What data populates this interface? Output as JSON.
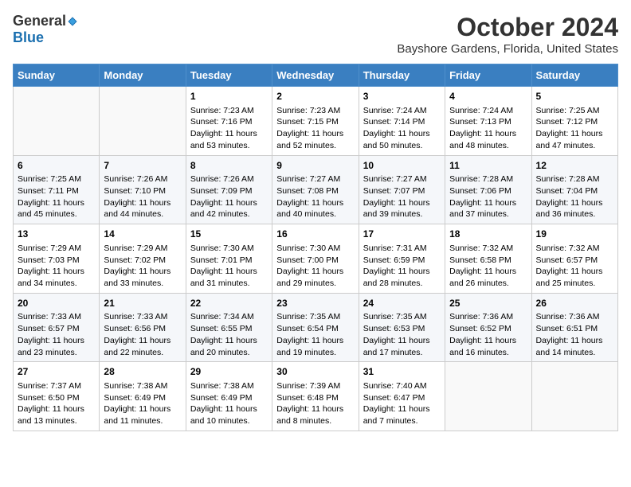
{
  "header": {
    "logo_general": "General",
    "logo_blue": "Blue",
    "month_title": "October 2024",
    "location": "Bayshore Gardens, Florida, United States"
  },
  "days_of_week": [
    "Sunday",
    "Monday",
    "Tuesday",
    "Wednesday",
    "Thursday",
    "Friday",
    "Saturday"
  ],
  "weeks": [
    [
      {
        "day": "",
        "data": ""
      },
      {
        "day": "",
        "data": ""
      },
      {
        "day": "1",
        "data": "Sunrise: 7:23 AM\nSunset: 7:16 PM\nDaylight: 11 hours and 53 minutes."
      },
      {
        "day": "2",
        "data": "Sunrise: 7:23 AM\nSunset: 7:15 PM\nDaylight: 11 hours and 52 minutes."
      },
      {
        "day": "3",
        "data": "Sunrise: 7:24 AM\nSunset: 7:14 PM\nDaylight: 11 hours and 50 minutes."
      },
      {
        "day": "4",
        "data": "Sunrise: 7:24 AM\nSunset: 7:13 PM\nDaylight: 11 hours and 48 minutes."
      },
      {
        "day": "5",
        "data": "Sunrise: 7:25 AM\nSunset: 7:12 PM\nDaylight: 11 hours and 47 minutes."
      }
    ],
    [
      {
        "day": "6",
        "data": "Sunrise: 7:25 AM\nSunset: 7:11 PM\nDaylight: 11 hours and 45 minutes."
      },
      {
        "day": "7",
        "data": "Sunrise: 7:26 AM\nSunset: 7:10 PM\nDaylight: 11 hours and 44 minutes."
      },
      {
        "day": "8",
        "data": "Sunrise: 7:26 AM\nSunset: 7:09 PM\nDaylight: 11 hours and 42 minutes."
      },
      {
        "day": "9",
        "data": "Sunrise: 7:27 AM\nSunset: 7:08 PM\nDaylight: 11 hours and 40 minutes."
      },
      {
        "day": "10",
        "data": "Sunrise: 7:27 AM\nSunset: 7:07 PM\nDaylight: 11 hours and 39 minutes."
      },
      {
        "day": "11",
        "data": "Sunrise: 7:28 AM\nSunset: 7:06 PM\nDaylight: 11 hours and 37 minutes."
      },
      {
        "day": "12",
        "data": "Sunrise: 7:28 AM\nSunset: 7:04 PM\nDaylight: 11 hours and 36 minutes."
      }
    ],
    [
      {
        "day": "13",
        "data": "Sunrise: 7:29 AM\nSunset: 7:03 PM\nDaylight: 11 hours and 34 minutes."
      },
      {
        "day": "14",
        "data": "Sunrise: 7:29 AM\nSunset: 7:02 PM\nDaylight: 11 hours and 33 minutes."
      },
      {
        "day": "15",
        "data": "Sunrise: 7:30 AM\nSunset: 7:01 PM\nDaylight: 11 hours and 31 minutes."
      },
      {
        "day": "16",
        "data": "Sunrise: 7:30 AM\nSunset: 7:00 PM\nDaylight: 11 hours and 29 minutes."
      },
      {
        "day": "17",
        "data": "Sunrise: 7:31 AM\nSunset: 6:59 PM\nDaylight: 11 hours and 28 minutes."
      },
      {
        "day": "18",
        "data": "Sunrise: 7:32 AM\nSunset: 6:58 PM\nDaylight: 11 hours and 26 minutes."
      },
      {
        "day": "19",
        "data": "Sunrise: 7:32 AM\nSunset: 6:57 PM\nDaylight: 11 hours and 25 minutes."
      }
    ],
    [
      {
        "day": "20",
        "data": "Sunrise: 7:33 AM\nSunset: 6:57 PM\nDaylight: 11 hours and 23 minutes."
      },
      {
        "day": "21",
        "data": "Sunrise: 7:33 AM\nSunset: 6:56 PM\nDaylight: 11 hours and 22 minutes."
      },
      {
        "day": "22",
        "data": "Sunrise: 7:34 AM\nSunset: 6:55 PM\nDaylight: 11 hours and 20 minutes."
      },
      {
        "day": "23",
        "data": "Sunrise: 7:35 AM\nSunset: 6:54 PM\nDaylight: 11 hours and 19 minutes."
      },
      {
        "day": "24",
        "data": "Sunrise: 7:35 AM\nSunset: 6:53 PM\nDaylight: 11 hours and 17 minutes."
      },
      {
        "day": "25",
        "data": "Sunrise: 7:36 AM\nSunset: 6:52 PM\nDaylight: 11 hours and 16 minutes."
      },
      {
        "day": "26",
        "data": "Sunrise: 7:36 AM\nSunset: 6:51 PM\nDaylight: 11 hours and 14 minutes."
      }
    ],
    [
      {
        "day": "27",
        "data": "Sunrise: 7:37 AM\nSunset: 6:50 PM\nDaylight: 11 hours and 13 minutes."
      },
      {
        "day": "28",
        "data": "Sunrise: 7:38 AM\nSunset: 6:49 PM\nDaylight: 11 hours and 11 minutes."
      },
      {
        "day": "29",
        "data": "Sunrise: 7:38 AM\nSunset: 6:49 PM\nDaylight: 11 hours and 10 minutes."
      },
      {
        "day": "30",
        "data": "Sunrise: 7:39 AM\nSunset: 6:48 PM\nDaylight: 11 hours and 8 minutes."
      },
      {
        "day": "31",
        "data": "Sunrise: 7:40 AM\nSunset: 6:47 PM\nDaylight: 11 hours and 7 minutes."
      },
      {
        "day": "",
        "data": ""
      },
      {
        "day": "",
        "data": ""
      }
    ]
  ]
}
